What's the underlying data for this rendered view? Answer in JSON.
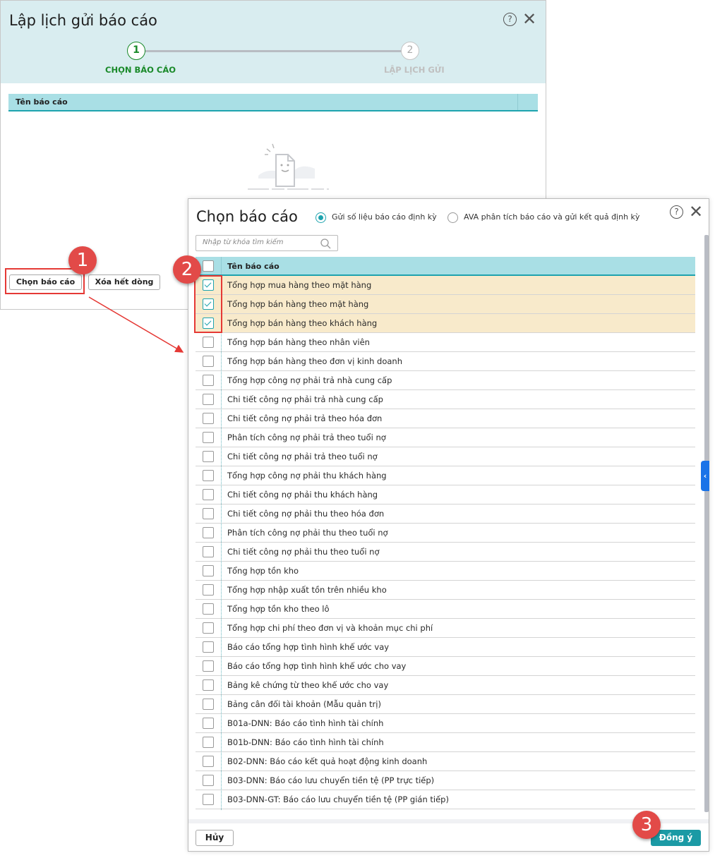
{
  "back_dialog": {
    "title": "Lập lịch gửi báo cáo",
    "steps": [
      {
        "number": "1",
        "label": "CHỌN BÁO CÁO",
        "active": true
      },
      {
        "number": "2",
        "label": "LẬP LỊCH GỬI",
        "active": false
      }
    ],
    "table_header": "Tên báo cáo",
    "buttons": {
      "choose": "Chọn báo cáo",
      "clear": "Xóa hết dòng"
    }
  },
  "front_dialog": {
    "title": "Chọn báo cáo",
    "options": [
      {
        "label": "Gửi số liệu báo cáo định kỳ",
        "selected": true
      },
      {
        "label": "AVA phân tích báo cáo và gửi kết quả định kỳ",
        "selected": false
      }
    ],
    "search_placeholder": "Nhập từ khóa tìm kiếm",
    "table_header": "Tên báo cáo",
    "rows": [
      {
        "name": "Tổng hợp mua hàng theo mặt hàng",
        "checked": true
      },
      {
        "name": "Tổng hợp bán hàng theo mặt hàng",
        "checked": true
      },
      {
        "name": "Tổng hợp bán hàng theo khách hàng",
        "checked": true
      },
      {
        "name": "Tổng hợp bán hàng theo nhân viên",
        "checked": false
      },
      {
        "name": "Tổng hợp bán hàng theo đơn vị kinh doanh",
        "checked": false
      },
      {
        "name": "Tổng hợp công nợ phải trả nhà cung cấp",
        "checked": false
      },
      {
        "name": "Chi tiết công nợ phải trả nhà cung cấp",
        "checked": false
      },
      {
        "name": "Chi tiết công nợ phải trả theo hóa đơn",
        "checked": false
      },
      {
        "name": "Phân tích công nợ phải trả theo tuổi nợ",
        "checked": false
      },
      {
        "name": "Chi tiết công nợ phải trả theo tuổi nợ",
        "checked": false
      },
      {
        "name": "Tổng hợp công nợ phải thu khách hàng",
        "checked": false
      },
      {
        "name": "Chi tiết công nợ phải thu khách hàng",
        "checked": false
      },
      {
        "name": "Chi tiết công nợ phải thu theo hóa đơn",
        "checked": false
      },
      {
        "name": "Phân tích công nợ phải thu theo tuổi nợ",
        "checked": false
      },
      {
        "name": "Chi tiết công nợ phải thu theo tuổi nợ",
        "checked": false
      },
      {
        "name": "Tổng hợp tồn kho",
        "checked": false
      },
      {
        "name": "Tổng hợp nhập xuất tồn trên nhiều kho",
        "checked": false
      },
      {
        "name": "Tổng hợp tồn kho theo lô",
        "checked": false
      },
      {
        "name": "Tổng hợp chi phí theo đơn vị và khoản mục chi phí",
        "checked": false
      },
      {
        "name": "Báo cáo tổng hợp tình hình khế ước vay",
        "checked": false
      },
      {
        "name": "Báo cáo tổng hợp tình hình khế ước cho vay",
        "checked": false
      },
      {
        "name": "Bảng kê chứng từ theo khế ước cho vay",
        "checked": false
      },
      {
        "name": "Bảng cân đối tài khoản (Mẫu quản trị)",
        "checked": false
      },
      {
        "name": "B01a-DNN: Báo cáo tình hình tài chính",
        "checked": false
      },
      {
        "name": "B01b-DNN: Báo cáo tình hình tài chính",
        "checked": false
      },
      {
        "name": "B02-DNN: Báo cáo kết quả hoạt động kinh doanh",
        "checked": false
      },
      {
        "name": "B03-DNN: Báo cáo lưu chuyển tiền tệ (PP trực tiếp)",
        "checked": false
      },
      {
        "name": "B03-DNN-GT: Báo cáo lưu chuyển tiền tệ (PP gián tiếp)",
        "checked": false
      }
    ],
    "buttons": {
      "cancel": "Hủy",
      "ok": "Đồng ý"
    }
  },
  "annotations": {
    "badge1": "1",
    "badge2": "2",
    "badge3": "3"
  },
  "colors": {
    "accent": "#1ea3ae",
    "step_active": "#1a8a2a",
    "annotation": "#e24a48",
    "selected_row": "#f8eacb",
    "header": "#a9dfe5"
  }
}
